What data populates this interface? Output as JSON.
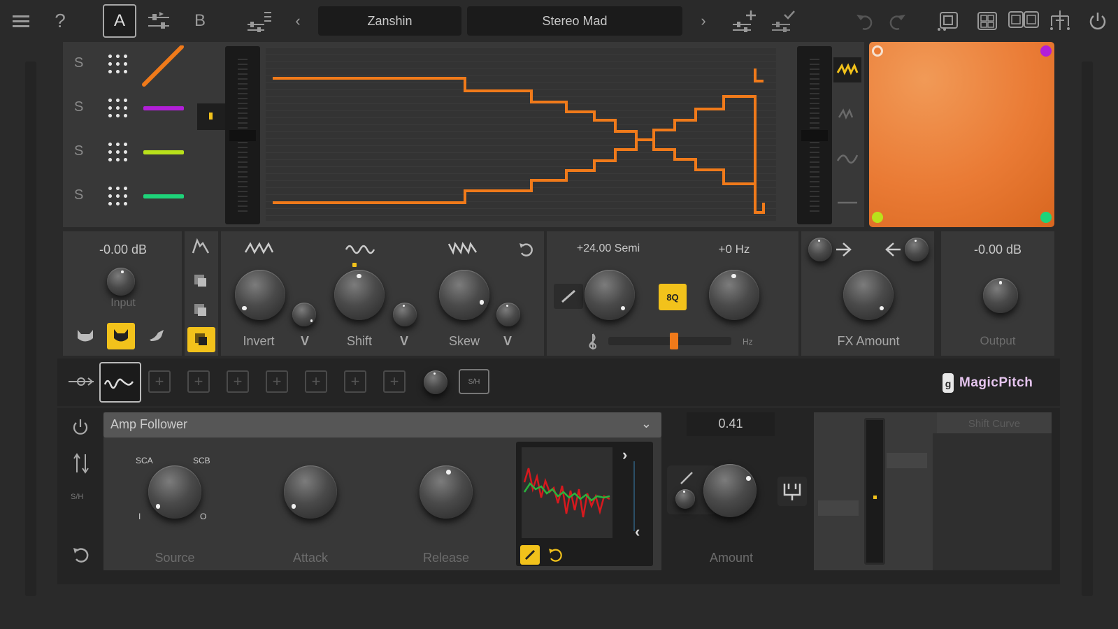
{
  "topbar": {
    "menu_icon": "hamburger-menu-icon",
    "help_label": "?",
    "a_label": "A",
    "b_label": "B",
    "preset_prev": "‹",
    "preset_next": "›",
    "preset_bank": "Zanshin",
    "preset_name": "Stereo Mad"
  },
  "lanes": [
    {
      "label": "S",
      "color": "#f07a1a"
    },
    {
      "label": "S",
      "color": "#b21fd8"
    },
    {
      "label": "S",
      "color": "#b9e11b"
    },
    {
      "label": "S",
      "color": "#1ed47a"
    }
  ],
  "input": {
    "value": "-0.00 dB",
    "label": "Input"
  },
  "shape": {
    "invert_label": "Invert",
    "shift_label": "Shift",
    "skew_label": "Skew",
    "chevron": "V"
  },
  "pitch": {
    "semi_value": "+24.00 Semi",
    "hz_value": "+0 Hz",
    "badge": "8Q",
    "hz_unit": "Hz"
  },
  "fx": {
    "label": "FX Amount"
  },
  "output": {
    "value": "-0.00 dB",
    "label": "Output"
  },
  "modbar": {
    "sh_label": "S/H",
    "brand": "MagicPitch"
  },
  "modulator": {
    "type": "Amp Follower",
    "source_label": "Source",
    "attack_label": "Attack",
    "release_label": "Release",
    "sca": "SCA",
    "scb": "SCB",
    "i": "I",
    "o": "O",
    "sh_side": "S/H",
    "amount_value": "0.41",
    "amount_label": "Amount",
    "shift_curve": "Shift Curve"
  },
  "colors": {
    "accent": "#f2c21b",
    "curve": "#f07a1a",
    "xy_pad": "#ea7b35"
  }
}
